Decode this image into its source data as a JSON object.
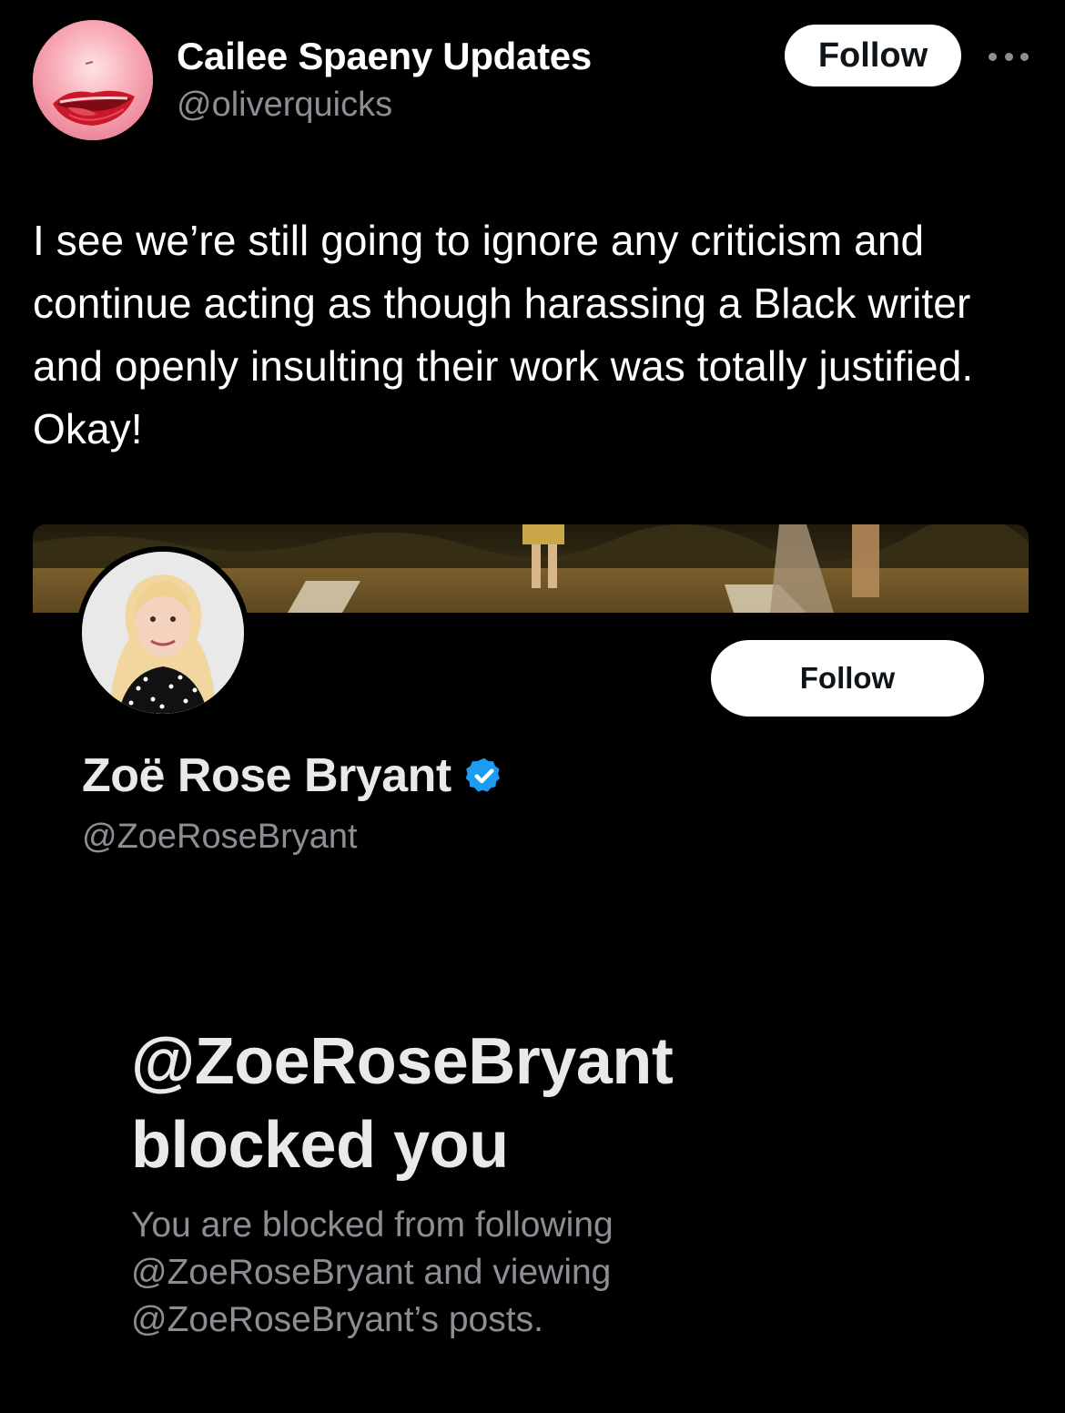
{
  "tweet": {
    "author": {
      "name": "Cailee Spaeny Updates",
      "handle": "@oliverquicks",
      "avatar_icon": "lips-avatar"
    },
    "follow_label": "Follow",
    "more_icon": "more-horizontal-icon",
    "text": "I see we’re still going to ignore any criticism and continue acting as though harassing a Black writer and openly insulting their work was totally justified. Okay!"
  },
  "embedded_profile": {
    "banner_image": "garden-scene-banner",
    "avatar_icon": "profile-photo-avatar",
    "follow_label": "Follow",
    "name": "Zoë Rose Bryant",
    "verified_icon": "verified-badge-icon",
    "verified_color": "#1d9bf0",
    "handle": "@ZoeRoseBryant",
    "blocked": {
      "title_line1": "@ZoeRoseBryant",
      "title_line2": "blocked you",
      "desc_line1": "You are blocked from following",
      "desc_line2": "@ZoeRoseBryant and viewing",
      "desc_line3": "@ZoeRoseBryant’s posts."
    }
  },
  "colors": {
    "background": "#000000",
    "primary_text": "#ffffff",
    "secondary_text": "#8b8f94",
    "button_bg": "#ffffff",
    "button_text": "#0f1419"
  }
}
